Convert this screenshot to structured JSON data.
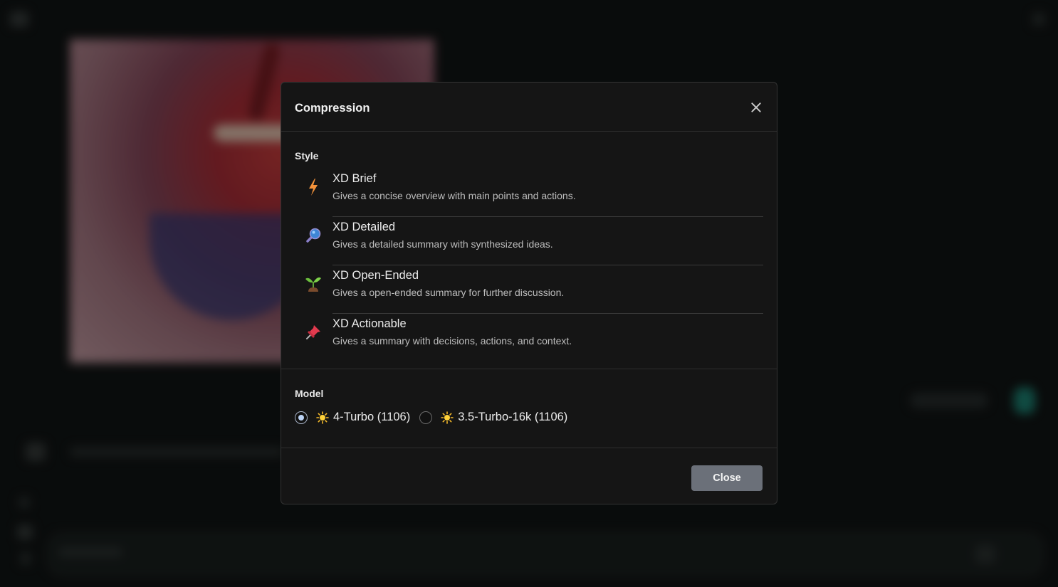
{
  "modal": {
    "title": "Compression",
    "style_label": "Style",
    "styles": [
      {
        "icon": "lightning-icon",
        "title": "XD Brief",
        "desc": "Gives a concise overview with main points and actions."
      },
      {
        "icon": "magnifier-icon",
        "title": "XD Detailed",
        "desc": "Gives a detailed summary with synthesized ideas."
      },
      {
        "icon": "seedling-icon",
        "title": "XD Open-Ended",
        "desc": "Gives a open-ended summary for further discussion."
      },
      {
        "icon": "pushpin-icon",
        "title": "XD Actionable",
        "desc": "Gives a summary with decisions, actions, and context."
      }
    ],
    "model_label": "Model",
    "models": [
      {
        "label": "4-Turbo (1106)",
        "selected": true,
        "icon": "sun-icon"
      },
      {
        "label": "3.5-Turbo-16k (1106)",
        "selected": false,
        "icon": "sun-icon"
      }
    ],
    "close_label": "Close"
  },
  "colors": {
    "modal_bg": "#151515",
    "close_button_bg": "#6b7079",
    "radio_selected": "#bcd3f5"
  }
}
